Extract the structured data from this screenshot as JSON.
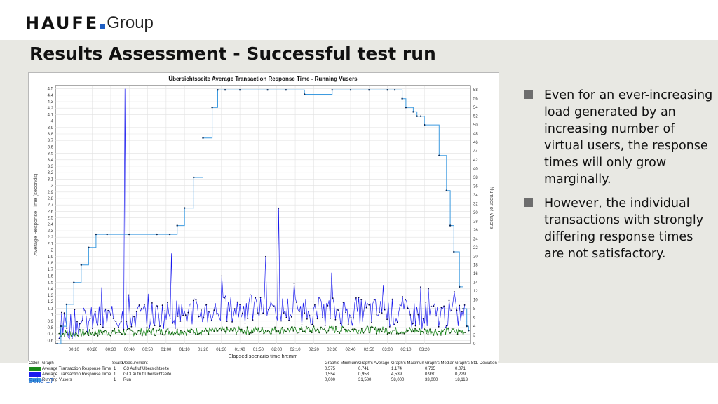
{
  "logo": {
    "brand": "HAUFE",
    "group": "Group"
  },
  "slide": {
    "title": "Results Assessment - Successful test run",
    "page_label": "Seite 17",
    "bullets": [
      "Even for an ever-increasing load generated by an increasing number of virtual users, the response times will only grow marginally.",
      "However, the individual transactions with strongly differing response times are not satisfactory."
    ]
  },
  "colors": {
    "green_series": "#1a8a1a",
    "blue_series": "#1a1aee",
    "vusers_series": "#3d9be0",
    "bullet": "#6d6d6d",
    "background": "#e8e8e3"
  },
  "chart_data": {
    "type": "line",
    "title": "Übersichtsseite Average Transaction Response Time - Running Vusers",
    "xlabel": "Elapsed scenario time hh:mm",
    "ylabel": "Average Response Time (seconds)",
    "y2label": "Number of Vusers",
    "x_ticks": [
      "00:10",
      "00:20",
      "00:30",
      "00:40",
      "00:50",
      "01:00",
      "01:10",
      "01:20",
      "01:30",
      "01:40",
      "01:50",
      "02:00",
      "02:10",
      "02:20",
      "02:30",
      "02:40",
      "02:50",
      "03:00",
      "03:10",
      "03:20"
    ],
    "x_range_minutes": [
      0,
      225
    ],
    "y_ticks": [
      "0,6",
      "0,7",
      "0,8",
      "0,9",
      "1",
      "1,1",
      "1,2",
      "1,3",
      "1,4",
      "1,5",
      "1,6",
      "1,7",
      "1,8",
      "1,9",
      "2",
      "2,1",
      "2,2",
      "2,3",
      "2,4",
      "2,5",
      "2,6",
      "2,7",
      "2,8",
      "2,9",
      "3",
      "3,1",
      "3,2",
      "3,3",
      "3,4",
      "3,5",
      "3,6",
      "3,7",
      "3,8",
      "3,9",
      "4",
      "4,1",
      "4,2",
      "4,3",
      "4,4",
      "4,5"
    ],
    "ylim": [
      0.55,
      4.55
    ],
    "y2_ticks": [
      "0",
      "2",
      "4",
      "6",
      "8",
      "10",
      "12",
      "14",
      "16",
      "18",
      "20",
      "22",
      "24",
      "26",
      "28",
      "30",
      "32",
      "34",
      "36",
      "38",
      "40",
      "42",
      "44",
      "46",
      "48",
      "50",
      "52",
      "54",
      "56",
      "58"
    ],
    "y2lim": [
      0,
      59
    ],
    "grid": true,
    "series": [
      {
        "name": "Average Transaction Response Time",
        "color": "#3d9be0",
        "axis": "right",
        "x": [
          1,
          3,
          6,
          10,
          14,
          18,
          22,
          28,
          40,
          55,
          62,
          66,
          70,
          75,
          80,
          85,
          88,
          92,
          100,
          115,
          125,
          135,
          150,
          160,
          170,
          180,
          184,
          188,
          190,
          194,
          196,
          198,
          200,
          208,
          212,
          214,
          216,
          219,
          221,
          223,
          224
        ],
        "y": [
          0,
          4,
          9,
          14,
          18,
          22,
          25,
          25,
          25,
          25,
          25,
          27,
          31,
          38,
          47,
          54,
          58,
          58,
          58,
          58,
          58,
          57,
          58,
          58,
          58,
          58,
          58,
          56,
          54,
          53,
          52,
          52,
          50,
          43,
          35,
          27,
          21,
          13,
          8,
          4,
          3
        ]
      },
      {
        "name": "Average Transaction Response Time",
        "color": "#1a1aee",
        "axis": "left",
        "base_values": [
          0.8,
          0.95,
          1.0,
          1.05,
          1.1,
          1.05,
          1.05,
          1.0,
          1.0
        ],
        "peaks": [
          {
            "x": 38,
            "y": 4.5
          },
          {
            "x": 63,
            "y": 1.95
          },
          {
            "x": 90,
            "y": 1.6
          },
          {
            "x": 114,
            "y": 1.9
          },
          {
            "x": 121,
            "y": 2.65
          },
          {
            "x": 150,
            "y": 1.65
          },
          {
            "x": 178,
            "y": 1.45
          }
        ]
      },
      {
        "name": "Running Vusers",
        "color": "#1a8a1a",
        "axis": "left",
        "base_values": [
          0.7,
          0.72,
          0.73,
          0.74,
          0.75,
          0.76,
          0.76,
          0.74,
          0.73
        ]
      }
    ]
  },
  "legend_table": {
    "headers": [
      "Color",
      "Graph",
      "Scale",
      "Measurement",
      "Graph's Minimum",
      "Graph's Average",
      "Graph's Maximum",
      "Graph's Median",
      "Graph's Std. Deviation"
    ],
    "rows": [
      {
        "color": "#1a8a1a",
        "graph": "Average Transaction Response Time",
        "scale": "1",
        "measurement": "G3 Aufruf Übersichtseite",
        "min": "0,575",
        "avg": "0,741",
        "max": "1,174",
        "median": "0,735",
        "std": "0,071"
      },
      {
        "color": "#1a1aee",
        "graph": "Average Transaction Response Time",
        "scale": "1",
        "measurement": "GL3 Aufruf Übersichtseite",
        "min": "0,554",
        "avg": "0,958",
        "max": "4,539",
        "median": "0,930",
        "std": "0,229"
      },
      {
        "color": "#3d9be0",
        "graph": "Running Vusers",
        "scale": "1",
        "measurement": "Run",
        "min": "0,000",
        "avg": "31,580",
        "max": "58,000",
        "median": "33,000",
        "std": "18,113"
      }
    ]
  }
}
